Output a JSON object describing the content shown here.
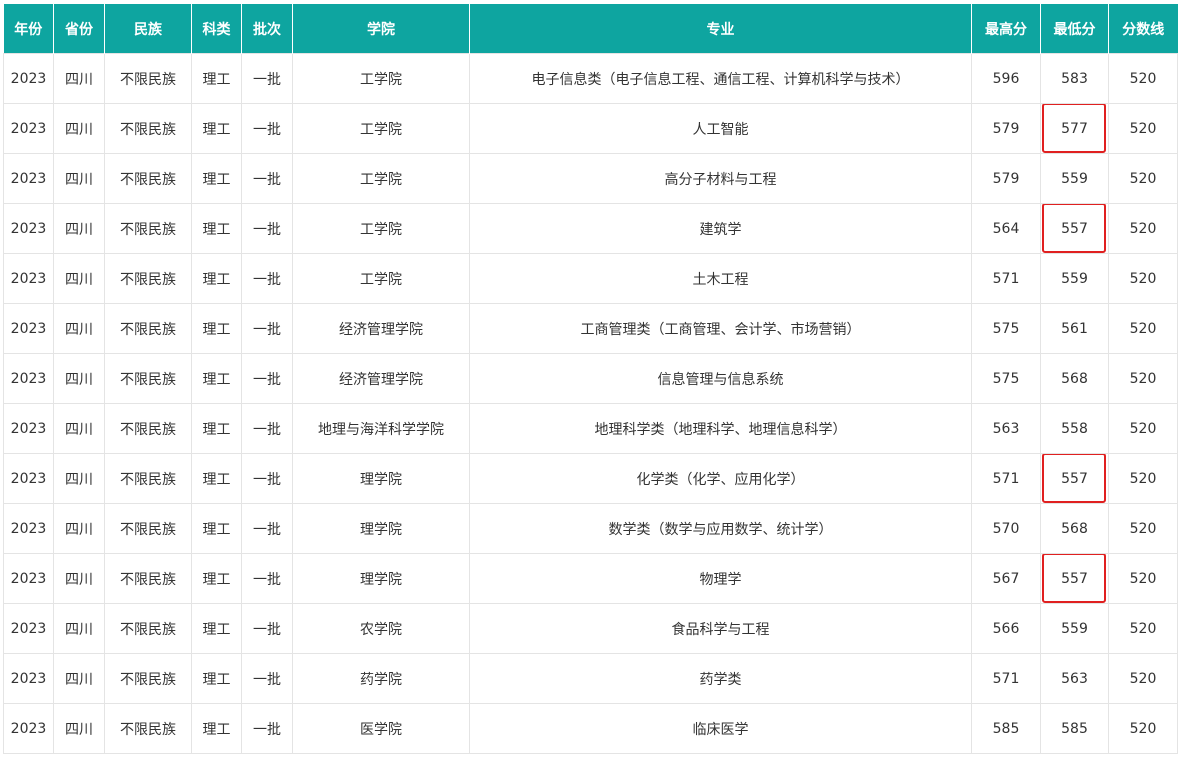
{
  "table": {
    "columns": [
      "年份",
      "省份",
      "民族",
      "科类",
      "批次",
      "学院",
      "专业",
      "最高分",
      "最低分",
      "分数线"
    ],
    "rows": [
      [
        "2023",
        "四川",
        "不限民族",
        "理工",
        "一批",
        "工学院",
        "电子信息类（电子信息工程、通信工程、计算机科学与技术）",
        "596",
        "583",
        "520"
      ],
      [
        "2023",
        "四川",
        "不限民族",
        "理工",
        "一批",
        "工学院",
        "人工智能",
        "579",
        "577",
        "520"
      ],
      [
        "2023",
        "四川",
        "不限民族",
        "理工",
        "一批",
        "工学院",
        "高分子材料与工程",
        "579",
        "559",
        "520"
      ],
      [
        "2023",
        "四川",
        "不限民族",
        "理工",
        "一批",
        "工学院",
        "建筑学",
        "564",
        "557",
        "520"
      ],
      [
        "2023",
        "四川",
        "不限民族",
        "理工",
        "一批",
        "工学院",
        "土木工程",
        "571",
        "559",
        "520"
      ],
      [
        "2023",
        "四川",
        "不限民族",
        "理工",
        "一批",
        "经济管理学院",
        "工商管理类（工商管理、会计学、市场营销）",
        "575",
        "561",
        "520"
      ],
      [
        "2023",
        "四川",
        "不限民族",
        "理工",
        "一批",
        "经济管理学院",
        "信息管理与信息系统",
        "575",
        "568",
        "520"
      ],
      [
        "2023",
        "四川",
        "不限民族",
        "理工",
        "一批",
        "地理与海洋科学学院",
        "地理科学类（地理科学、地理信息科学）",
        "563",
        "558",
        "520"
      ],
      [
        "2023",
        "四川",
        "不限民族",
        "理工",
        "一批",
        "理学院",
        "化学类（化学、应用化学）",
        "571",
        "557",
        "520"
      ],
      [
        "2023",
        "四川",
        "不限民族",
        "理工",
        "一批",
        "理学院",
        "数学类（数学与应用数学、统计学）",
        "570",
        "568",
        "520"
      ],
      [
        "2023",
        "四川",
        "不限民族",
        "理工",
        "一批",
        "理学院",
        "物理学",
        "567",
        "557",
        "520"
      ],
      [
        "2023",
        "四川",
        "不限民族",
        "理工",
        "一批",
        "农学院",
        "食品科学与工程",
        "566",
        "559",
        "520"
      ],
      [
        "2023",
        "四川",
        "不限民族",
        "理工",
        "一批",
        "药学院",
        "药学类",
        "571",
        "563",
        "520"
      ],
      [
        "2023",
        "四川",
        "不限民族",
        "理工",
        "一批",
        "医学院",
        "临床医学",
        "585",
        "585",
        "520"
      ]
    ],
    "highlighted_rows": [
      1,
      3,
      8,
      10
    ],
    "highlight_column": "最低分"
  },
  "colors": {
    "header_bg": "#0ea5a0",
    "header_text": "#ffffff",
    "highlight_border": "#e02020",
    "cell_border": "#e4e4e4"
  }
}
